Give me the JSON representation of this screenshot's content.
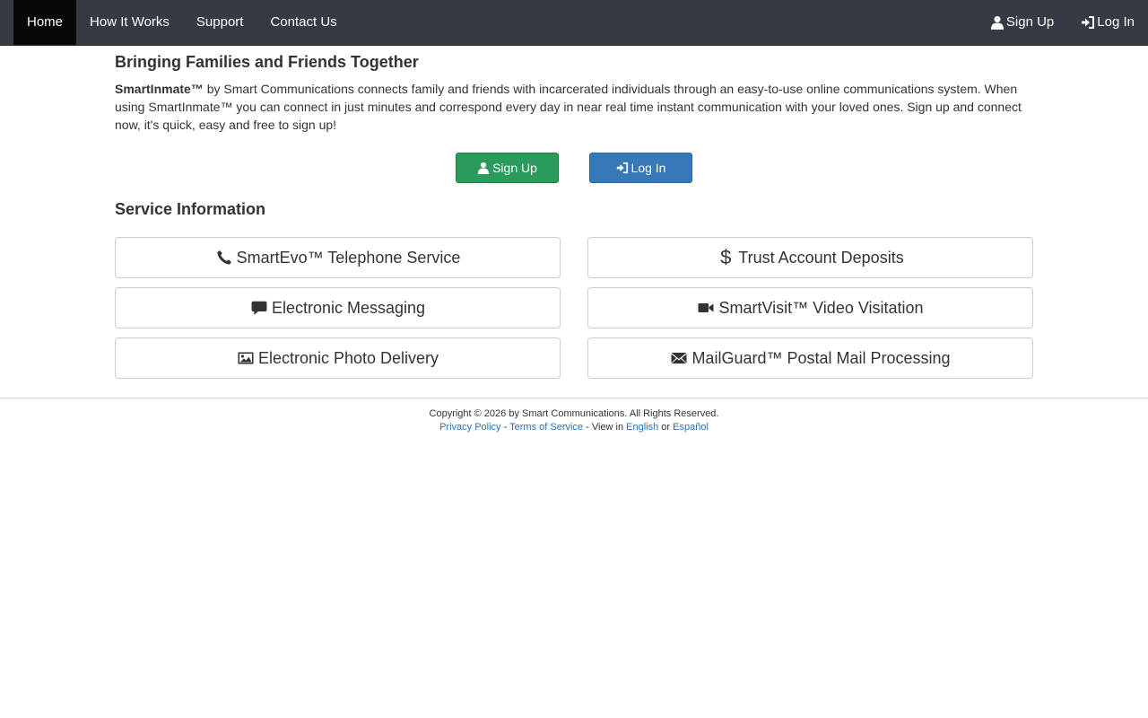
{
  "nav": {
    "left": [
      {
        "label": "Home",
        "active": true
      },
      {
        "label": "How It Works"
      },
      {
        "label": "Support"
      },
      {
        "label": "Contact Us"
      }
    ],
    "right": [
      {
        "label": "Sign Up",
        "icon": "user-icon"
      },
      {
        "label": "Log In",
        "icon": "login-icon"
      }
    ]
  },
  "main": {
    "title": "Bringing Families and Friends Together",
    "intro": {
      "brand": "SmartInmate™",
      "text": " by Smart Communications connects family and friends with incarcerated individuals through an easy-to-use online communications system. When using SmartInmate™ you can connect in just minutes and correspond every day in near real time instant communication with your loved ones. Sign up and connect now, it's quick, easy and free to sign up!"
    },
    "signup_label": "Sign Up",
    "login_label": "Log In",
    "service_title": "Service Information",
    "services": [
      {
        "label": "SmartEvo™ Telephone Service",
        "icon": "phone-icon"
      },
      {
        "label": "Trust Account Deposits",
        "icon": "dollar-icon"
      },
      {
        "label": "Electronic Messaging",
        "icon": "message-icon"
      },
      {
        "label": "SmartVisit™ Video Visitation",
        "icon": "video-icon"
      },
      {
        "label": "Electronic Photo Delivery",
        "icon": "photo-icon"
      },
      {
        "label": "MailGuard™ Postal Mail Processing",
        "icon": "envelope-icon"
      }
    ]
  },
  "footer": {
    "copyright": "Copyright © 2026 by Smart Communications. All Rights Reserved.",
    "privacy": "Privacy Policy",
    "sep1": " - ",
    "terms": "Terms of Service",
    "view_in": " - View in ",
    "english": "English",
    "or": " or ",
    "espanol": "Español"
  },
  "colors": {
    "navbar": "#363a42",
    "nav_active": "#080808",
    "signup_green": "#2a9b5b",
    "login_blue": "#3579b8",
    "link_blue": "#2a6fb0"
  }
}
